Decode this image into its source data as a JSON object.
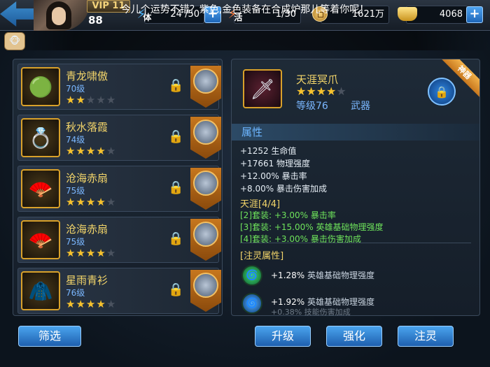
{
  "header": {
    "vip_label": "VIP 11",
    "player_level": "88",
    "stamina": {
      "icon_label": "体",
      "value": "24 /50"
    },
    "vigor": {
      "icon_label": "活",
      "value": "1/30"
    },
    "gold": {
      "value": "1621万"
    },
    "ingot": {
      "value": "4068"
    }
  },
  "notice": "今儿个运势不错？紫色,金色装备在合成炉那儿等着你呢！",
  "equipment_list": [
    {
      "name": "青龙啸傲",
      "level": "70级",
      "stars": 2,
      "icon": "jade-disc-icon"
    },
    {
      "name": "秋水落霞",
      "level": "74级",
      "stars": 4,
      "icon": "gold-ring-icon"
    },
    {
      "name": "沧海赤扇",
      "level": "75级",
      "stars": 4,
      "icon": "red-fan-icon"
    },
    {
      "name": "沧海赤扇",
      "level": "75级",
      "stars": 4,
      "icon": "red-fan-icon"
    },
    {
      "name": "星雨青衫",
      "level": "76级",
      "stars": 4,
      "icon": "robe-icon"
    }
  ],
  "filter_label": "筛选",
  "detail": {
    "name": "天涯冥爪",
    "stars": 4,
    "level_label": "等级76",
    "type": "武器",
    "ribbon": "神器",
    "attributes_header": "属性",
    "stats": [
      "+1252 生命值",
      "+17661 物理强度",
      "+12.00% 暴击率",
      "+8.00% 暴击伤害加成"
    ],
    "set_title": "天涯[4/4]",
    "set_bonuses": [
      "[2]套装: +3.00% 暴击率",
      "[3]套装: +15.00% 英雄基础物理强度",
      "[4]套装: +3.00% 暴击伤害加成"
    ],
    "soul_title": "[注灵属性]",
    "souls": [
      {
        "value": "+1.28%",
        "desc": "英雄基础物理强度"
      },
      {
        "value": "+1.92%",
        "desc": "英雄基础物理强度"
      }
    ],
    "soul_faded": "+0.38% 技能伤害加成"
  },
  "actions": {
    "upgrade": "升级",
    "enhance": "强化",
    "infuse": "注灵"
  },
  "colors": {
    "accent_blue": "#2e86e2",
    "gold_text": "#f3d56a",
    "set_green": "#6ee35b"
  }
}
